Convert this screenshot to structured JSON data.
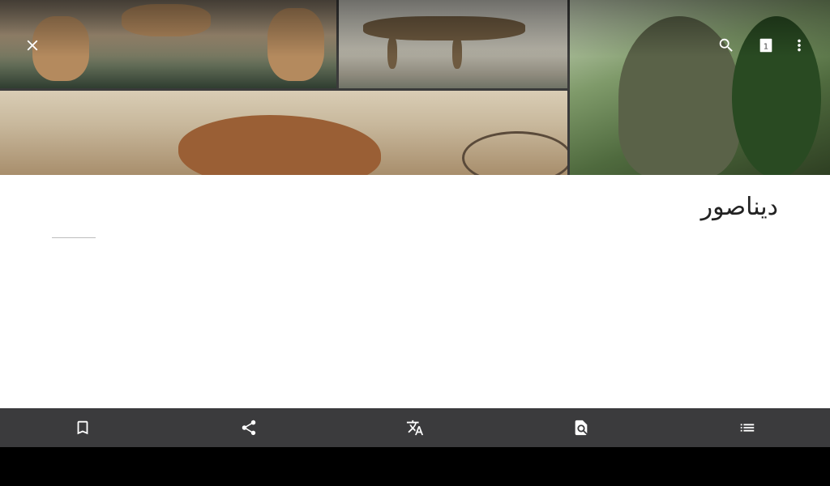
{
  "article": {
    "title": "دیناصور"
  },
  "hero_images": [
    {
      "name": "fossil-skeleton-hall"
    },
    {
      "name": "stegosaurus-skeleton"
    },
    {
      "name": "dinosaur-skull-fossil"
    },
    {
      "name": "dinosaur-statue-in-trees"
    }
  ],
  "toolbar_top": {
    "icons": [
      "close-icon",
      "search-icon",
      "tabs-icon",
      "more-vert-icon"
    ],
    "tabs_count": "1"
  },
  "toolbar_bottom": {
    "icons": [
      "bookmark-icon",
      "share-icon",
      "translate-icon",
      "find-in-page-icon",
      "table-of-contents-icon"
    ]
  },
  "colors": {
    "bottom_bar": "#3b3b3d",
    "icon": "#ffffff",
    "title_text": "#222222"
  }
}
